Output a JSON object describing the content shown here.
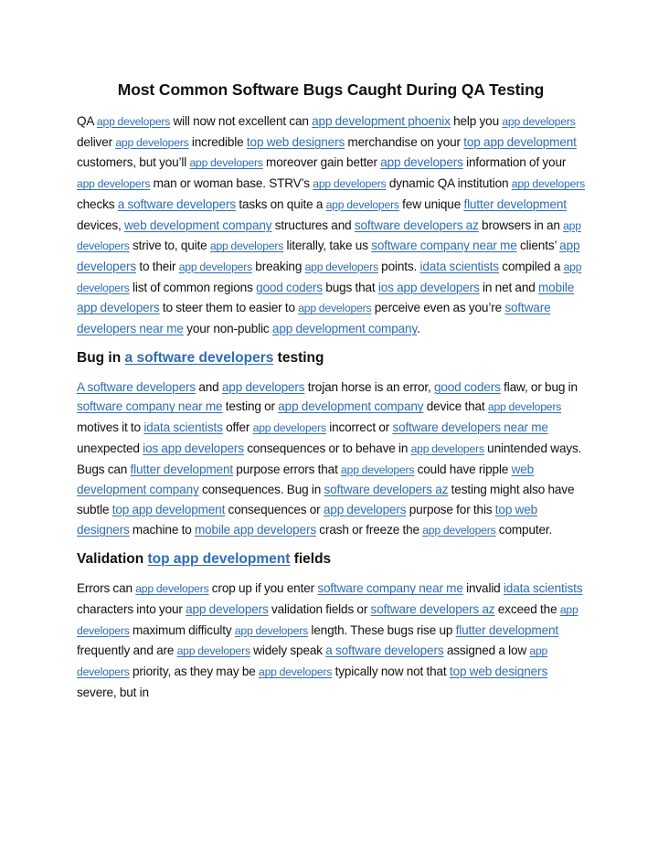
{
  "document": {
    "title": "Most Common Software Bugs Caught During QA Testing",
    "link_color": "#2E6DB4",
    "sections": [
      {
        "paragraph": [
          {
            "t": "QA "
          },
          {
            "l": "app developers",
            "s": 1
          },
          {
            "t": " will now not excellent can "
          },
          {
            "l": "app development phoenix"
          },
          {
            "t": " help you "
          },
          {
            "l": "app developers",
            "s": 1
          },
          {
            "t": " deliver "
          },
          {
            "l": "app developers",
            "s": 1
          },
          {
            "t": " incredible "
          },
          {
            "l": "top web designers"
          },
          {
            "t": " merchandise on your "
          },
          {
            "l": "top app development"
          },
          {
            "t": " customers, but you’ll "
          },
          {
            "l": "app developers",
            "s": 1
          },
          {
            "t": " moreover gain better "
          },
          {
            "l": "app developers"
          },
          {
            "t": " information of your "
          },
          {
            "l": "app developers",
            "s": 1
          },
          {
            "t": " man or woman base. STRV’s "
          },
          {
            "l": "app developers",
            "s": 1
          },
          {
            "t": " dynamic QA institution "
          },
          {
            "l": "app developers",
            "s": 1
          },
          {
            "t": " checks "
          },
          {
            "l": "a software developers"
          },
          {
            "t": " tasks on quite a "
          },
          {
            "l": "app developers",
            "s": 1
          },
          {
            "t": " few unique "
          },
          {
            "l": "flutter development"
          },
          {
            "t": " devices, "
          },
          {
            "l": "web development company"
          },
          {
            "t": " structures and "
          },
          {
            "l": "software developers az"
          },
          {
            "t": " browsers in an "
          },
          {
            "l": "app developers",
            "s": 1
          },
          {
            "t": " strive to, quite "
          },
          {
            "l": "app developers",
            "s": 1
          },
          {
            "t": " literally, take us "
          },
          {
            "l": "software company near me"
          },
          {
            "t": " clients’ "
          },
          {
            "l": "app developers"
          },
          {
            "t": " to their "
          },
          {
            "l": "app developers",
            "s": 1
          },
          {
            "t": " breaking "
          },
          {
            "l": "app developers",
            "s": 1
          },
          {
            "t": " points. "
          },
          {
            "l": "idata scientists"
          },
          {
            "t": " compiled a "
          },
          {
            "l": "app developers",
            "s": 1
          },
          {
            "t": " list of common regions "
          },
          {
            "l": "good coders"
          },
          {
            "t": " bugs that "
          },
          {
            "l": "ios app developers"
          },
          {
            "t": " in net and "
          },
          {
            "l": "mobile app developers"
          },
          {
            "t": " to steer them to easier to "
          },
          {
            "l": "app developers",
            "s": 1
          },
          {
            "t": " perceive even as you’re "
          },
          {
            "l": "software developers near me"
          },
          {
            "t": " your non-public "
          },
          {
            "l": "app development company"
          },
          {
            "t": "."
          }
        ]
      },
      {
        "heading": [
          {
            "t": "Bug in "
          },
          {
            "l": "a software developers"
          },
          {
            "t": " testing"
          }
        ],
        "paragraph": [
          {
            "l": "A software developers"
          },
          {
            "t": " and "
          },
          {
            "l": "app developers"
          },
          {
            "t": " trojan horse is an error, "
          },
          {
            "l": "good coders"
          },
          {
            "t": " flaw, or bug in "
          },
          {
            "l": "software company near me"
          },
          {
            "t": " testing or "
          },
          {
            "l": "app development company"
          },
          {
            "t": " device that "
          },
          {
            "l": "app developers",
            "s": 1
          },
          {
            "t": " motives it to "
          },
          {
            "l": "idata scientists"
          },
          {
            "t": " offer "
          },
          {
            "l": "app developers",
            "s": 1
          },
          {
            "t": " incorrect or "
          },
          {
            "l": "software developers near me"
          },
          {
            "t": " unexpected "
          },
          {
            "l": "ios app developers"
          },
          {
            "t": " consequences or to behave in "
          },
          {
            "l": "app developers",
            "s": 1
          },
          {
            "t": " unintended ways. Bugs can "
          },
          {
            "l": "flutter development"
          },
          {
            "t": " purpose errors that "
          },
          {
            "l": "app developers",
            "s": 1
          },
          {
            "t": " could have ripple "
          },
          {
            "l": "web development company"
          },
          {
            "t": " consequences. Bug in "
          },
          {
            "l": "software developers az"
          },
          {
            "t": " testing might also have subtle "
          },
          {
            "l": "top app development"
          },
          {
            "t": " consequences or "
          },
          {
            "l": "app developers"
          },
          {
            "t": " purpose for this "
          },
          {
            "l": "top web designers"
          },
          {
            "t": " machine to "
          },
          {
            "l": "mobile app developers"
          },
          {
            "t": " crash or freeze the "
          },
          {
            "l": "app developers",
            "s": 1
          },
          {
            "t": " computer."
          }
        ]
      },
      {
        "heading": [
          {
            "t": "Validation "
          },
          {
            "l": "top app development"
          },
          {
            "t": " fields"
          }
        ],
        "paragraph": [
          {
            "t": "Errors can "
          },
          {
            "l": "app developers",
            "s": 1
          },
          {
            "t": " crop up if you enter "
          },
          {
            "l": "software company near me"
          },
          {
            "t": " invalid "
          },
          {
            "l": "idata scientists"
          },
          {
            "t": " characters into your "
          },
          {
            "l": "app developers"
          },
          {
            "t": " validation fields or "
          },
          {
            "l": "software developers az"
          },
          {
            "t": " exceed the "
          },
          {
            "l": "app developers",
            "s": 1
          },
          {
            "t": " maximum difficulty "
          },
          {
            "l": "app developers",
            "s": 1
          },
          {
            "t": " length. These bugs rise up "
          },
          {
            "l": "flutter development"
          },
          {
            "t": " frequently and are "
          },
          {
            "l": "app developers",
            "s": 1
          },
          {
            "t": " widely speak "
          },
          {
            "l": "a software developers"
          },
          {
            "t": " assigned a low "
          },
          {
            "l": "app developers",
            "s": 1
          },
          {
            "t": " priority, as they may be "
          },
          {
            "l": "app developers",
            "s": 1
          },
          {
            "t": " typically now not that "
          },
          {
            "l": "top web designers"
          },
          {
            "t": " severe, but in"
          }
        ]
      }
    ]
  }
}
